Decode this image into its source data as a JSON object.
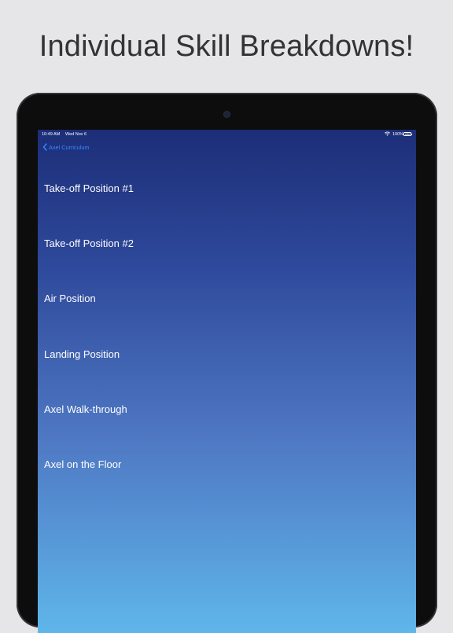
{
  "headline": "Individual Skill Breakdowns!",
  "status_bar": {
    "time": "10:49 AM",
    "date": "Wed Nov 6",
    "battery_percent": "100%",
    "battery_level": 1.0,
    "wifi_icon": "wifi-icon",
    "battery_icon": "battery-icon"
  },
  "navigation": {
    "back_label": "Axel Curriculum",
    "back_icon": "chevron-left-icon",
    "accent_color": "#3a88ff"
  },
  "skills": [
    {
      "label": "Take-off Position #1"
    },
    {
      "label": "Take-off Position #2"
    },
    {
      "label": "Air Position"
    },
    {
      "label": "Landing Position"
    },
    {
      "label": "Axel Walk-through"
    },
    {
      "label": "Axel on the Floor"
    }
  ],
  "colors": {
    "background": "#e6e5e8",
    "headline_text": "#333333",
    "device_frame": "#0d0d0e",
    "gradient_top": "#1c2e78",
    "gradient_bottom": "#5fb6ea",
    "list_text": "#ffffff"
  }
}
